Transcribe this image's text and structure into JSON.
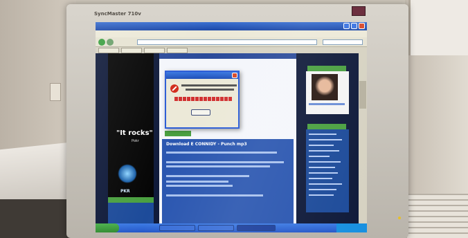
{
  "monitor": {
    "brand": "SyncMaster 710v"
  },
  "ad": {
    "headline": "\"It rocks\"",
    "tagline": "Pokr",
    "logo_text": "PKR"
  },
  "article": {
    "title": "Download E CONNIDY - Punch mp3"
  },
  "icons": [
    "warning-icon",
    "back-icon",
    "forward-icon",
    "start-icon"
  ],
  "colors": {
    "site_blue": "#2a56b0",
    "site_green": "#4aa040",
    "xp_blue": "#2457c8"
  }
}
